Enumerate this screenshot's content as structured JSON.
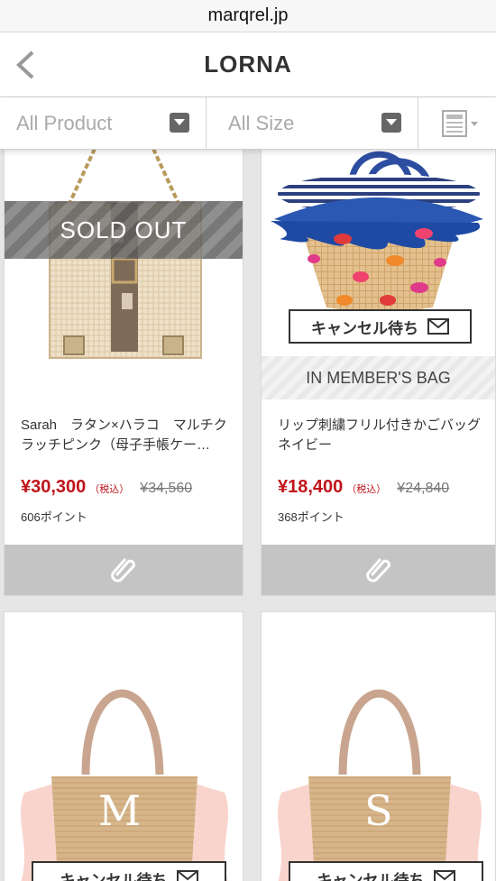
{
  "browser": {
    "url": "marqrel.jp"
  },
  "header": {
    "title": "LORNA"
  },
  "filters": {
    "product": "All Product",
    "size": "All Size"
  },
  "products": [
    {
      "name": "Sarah　ラタン×ハラコ　マルチクラッチピンク（母子手帳ケー…",
      "price": "¥30,300",
      "tax": "（税込）",
      "original_price": "¥34,560",
      "points": "606ポイント",
      "overlay": "SOLD OUT"
    },
    {
      "name": "リップ刺繍フリル付きかごバッグ　ネイビー",
      "price": "¥18,400",
      "tax": "（税込）",
      "original_price": "¥24,840",
      "points": "368ポイント",
      "wait_label": "キャンセル待ち",
      "member_bag": "IN MEMBER'S BAG"
    },
    {
      "initial": "M",
      "wait_label": "キャンセル待ち"
    },
    {
      "initial": "S",
      "wait_label": "キャンセル待ち"
    }
  ],
  "icons": {
    "back": "chevron-left-icon",
    "dropdown": "dropdown-arrow-icon",
    "view": "list-view-icon",
    "clip": "paperclip-icon",
    "mail": "envelope-icon"
  }
}
